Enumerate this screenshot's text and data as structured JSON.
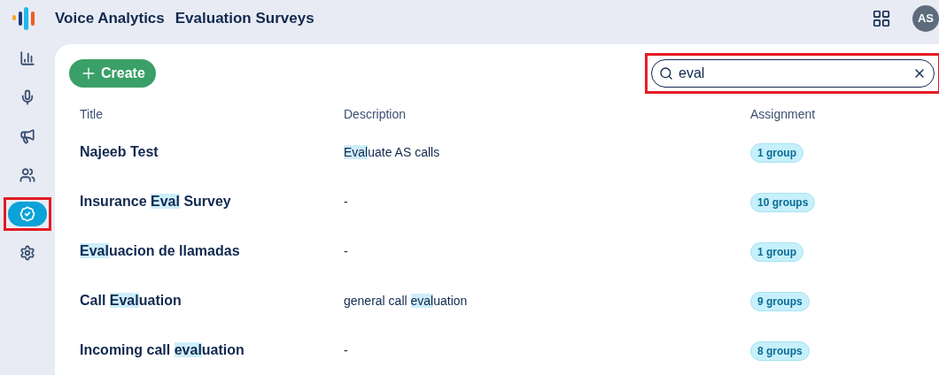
{
  "app": {
    "name": "Voice Analytics",
    "page_title": "Evaluation Surveys",
    "avatar": "AS"
  },
  "nav": [
    {
      "kind": "chart",
      "selected": false,
      "highlighted": false
    },
    {
      "kind": "mic",
      "selected": false,
      "highlighted": false
    },
    {
      "kind": "megaphone",
      "selected": false,
      "highlighted": false
    },
    {
      "kind": "users",
      "selected": false,
      "highlighted": false
    },
    {
      "kind": "survey",
      "selected": true,
      "highlighted": true
    },
    {
      "kind": "settings",
      "selected": false,
      "highlighted": false
    }
  ],
  "create_button": "Create",
  "search": {
    "value": "eval",
    "highlighted": true
  },
  "table": {
    "columns": [
      "Title",
      "Description",
      "Assignment"
    ],
    "rows": [
      {
        "title": [
          {
            "text": "Najeeb Test",
            "match": false
          }
        ],
        "description": [
          {
            "text": "Eval",
            "match": true
          },
          {
            "text": "uate AS calls",
            "match": false
          }
        ],
        "assignment": "1 group"
      },
      {
        "title": [
          {
            "text": "Insurance ",
            "match": false
          },
          {
            "text": "Eval",
            "match": true
          },
          {
            "text": " Survey",
            "match": false
          }
        ],
        "description": [
          {
            "text": "-",
            "match": false
          }
        ],
        "assignment": "10 groups"
      },
      {
        "title": [
          {
            "text": "Eval",
            "match": true
          },
          {
            "text": "uacion de llamadas",
            "match": false
          }
        ],
        "description": [
          {
            "text": "-",
            "match": false
          }
        ],
        "assignment": "1 group"
      },
      {
        "title": [
          {
            "text": "Call ",
            "match": false
          },
          {
            "text": "Eval",
            "match": true
          },
          {
            "text": "uation",
            "match": false
          }
        ],
        "description": [
          {
            "text": "general call ",
            "match": false
          },
          {
            "text": "eval",
            "match": true
          },
          {
            "text": "uation",
            "match": false
          }
        ],
        "assignment": "9 groups"
      },
      {
        "title": [
          {
            "text": "Incoming call ",
            "match": false
          },
          {
            "text": "eval",
            "match": true
          },
          {
            "text": "uation",
            "match": false
          }
        ],
        "description": [
          {
            "text": "-",
            "match": false
          }
        ],
        "assignment": "8 groups"
      }
    ]
  }
}
